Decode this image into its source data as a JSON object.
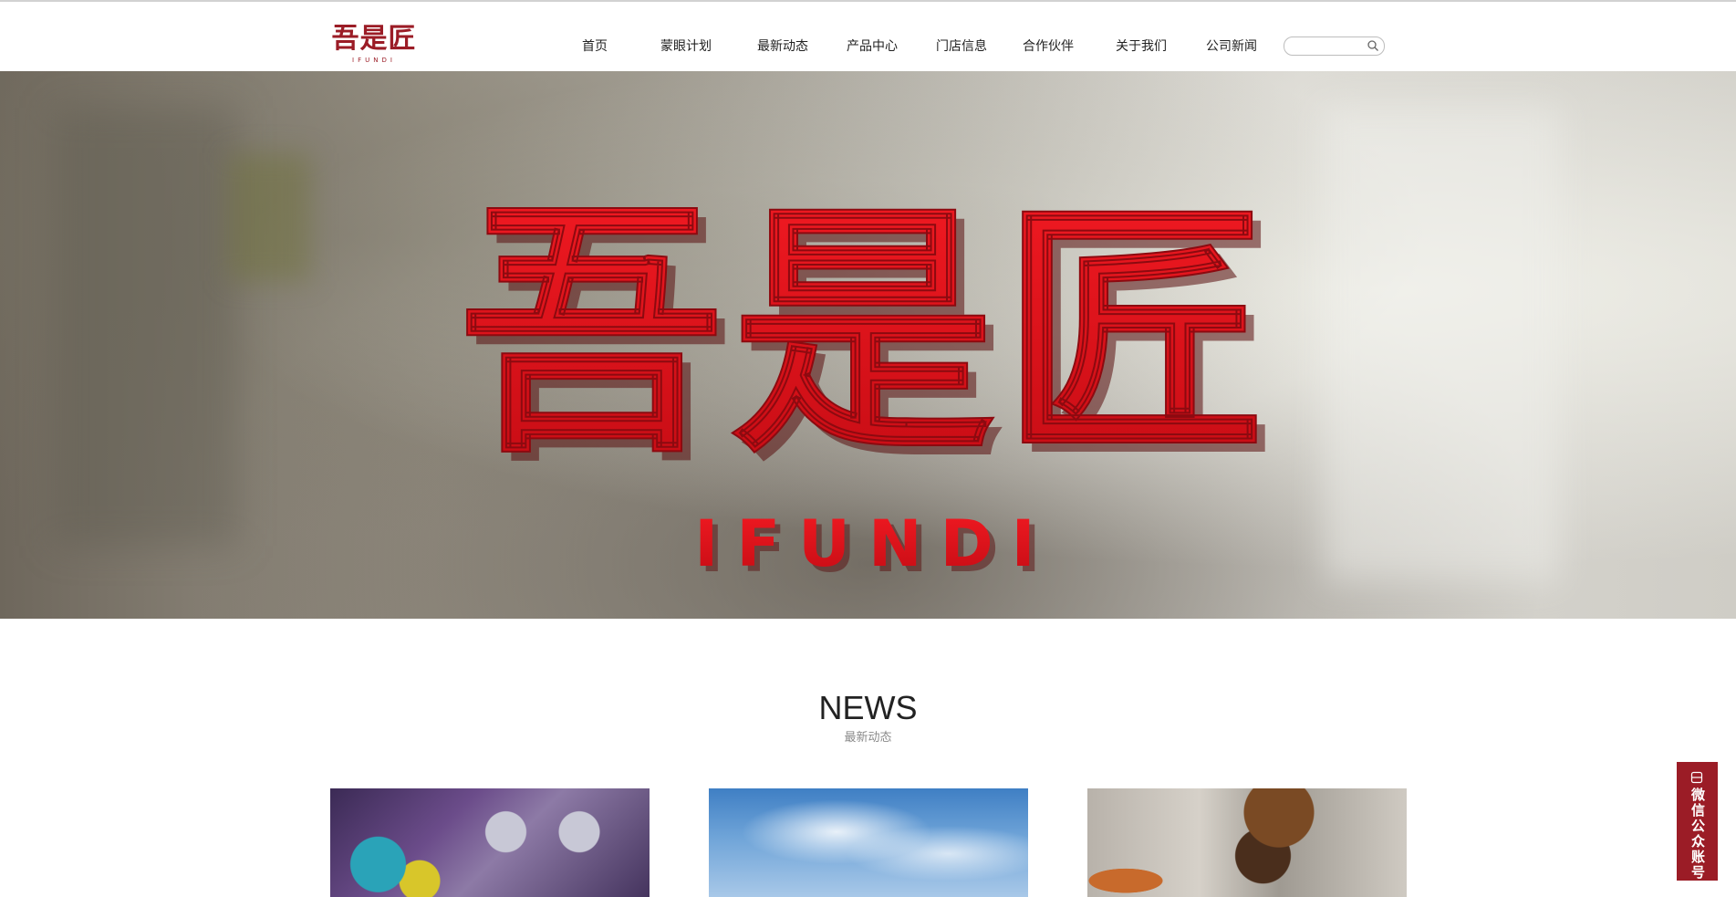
{
  "brand": {
    "logo_cn": "吾是匠",
    "logo_en": "IFUNDI",
    "color": "#9b1c26"
  },
  "nav": {
    "items": [
      {
        "label": "首页"
      },
      {
        "label": "蒙眼计划"
      },
      {
        "label": "最新动态"
      },
      {
        "label": "产品中心"
      },
      {
        "label": "门店信息"
      },
      {
        "label": "合作伙伴"
      },
      {
        "label": "关于我们"
      },
      {
        "label": "公司新闻"
      }
    ]
  },
  "search": {
    "value": "",
    "placeholder": "",
    "icon": "search-icon"
  },
  "hero": {
    "sign_cn": "吾是匠",
    "sign_en": "IFUNDI",
    "sign_color": "#e0121c"
  },
  "news": {
    "title": "NEWS",
    "subtitle": "最新动态"
  },
  "side_tab": {
    "label": "微信公众账号",
    "icon": "wechat-account-icon"
  }
}
